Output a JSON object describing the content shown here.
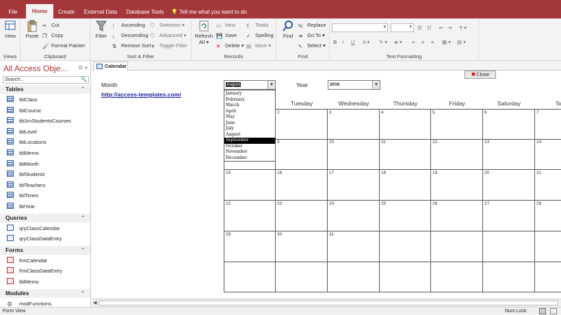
{
  "tabs": {
    "file": "File",
    "home": "Home",
    "create": "Create",
    "external": "External Data",
    "dbtools": "Database Tools",
    "tellme": "Tell me what you want to do"
  },
  "ribbon": {
    "views": {
      "label": "Views",
      "view": "View"
    },
    "clipboard": {
      "label": "Clipboard",
      "paste": "Paste",
      "cut": "Cut",
      "copy": "Copy",
      "format_painter": "Format Painter"
    },
    "sort_filter": {
      "label": "Sort & Filter",
      "filter": "Filter",
      "ascending": "Ascending",
      "descending": "Descending",
      "remove_sort": "Remove Sort",
      "selection": "Selection",
      "advanced": "Advanced",
      "toggle_filter": "Toggle Filter"
    },
    "records": {
      "label": "Records",
      "refresh": "Refresh",
      "all": "All",
      "new": "New",
      "save": "Save",
      "delete": "Delete",
      "totals": "Totals",
      "spelling": "Spelling",
      "more": "More"
    },
    "find": {
      "label": "Find",
      "find": "Find",
      "replace": "Replace",
      "goto": "Go To",
      "select": "Select"
    },
    "text_formatting": {
      "label": "Text Formatting",
      "bold": "B",
      "italic": "I",
      "underline": "U"
    }
  },
  "nav": {
    "title": "All Access Obje...",
    "search_placeholder": "Search...",
    "categories": [
      {
        "name": "Tables",
        "kind": "table",
        "items": [
          "tblClass",
          "tblCourse",
          "tblJrnStudentsCourses",
          "tblLevel",
          "tblLocations",
          "tblMemo",
          "tblMonth",
          "tblStudents",
          "tblTeachers",
          "tblTimes",
          "tblYear"
        ]
      },
      {
        "name": "Queries",
        "kind": "query",
        "items": [
          "qryClassCalendar",
          "qryClassDataEntry"
        ]
      },
      {
        "name": "Forms",
        "kind": "form",
        "items": [
          "frmCalendar",
          "frmClassDataEntry",
          "tblMemo"
        ]
      },
      {
        "name": "Modules",
        "kind": "module",
        "items": [
          "modFunctions"
        ]
      }
    ]
  },
  "document": {
    "tab": "Calendar"
  },
  "form": {
    "close": "Close",
    "month_label": "Month",
    "month_value": "August",
    "year_label": "Year",
    "year_value": "2016",
    "link": "http://access-templates.com/",
    "months": [
      "January",
      "February",
      "March",
      "April",
      "May",
      "June",
      "July",
      "August",
      "September",
      "October",
      "November",
      "December"
    ],
    "highlighted_month": "September",
    "weekdays": [
      "",
      "Tuesday",
      "Wednesday",
      "Thursday",
      "Friday",
      "Saturday",
      "Sun"
    ],
    "weeks": [
      [
        "",
        "2",
        "3",
        "4",
        "5",
        "6",
        "7"
      ],
      [
        "",
        "9",
        "10",
        "11",
        "12",
        "13",
        "14"
      ],
      [
        "15",
        "16",
        "17",
        "18",
        "19",
        "20",
        "21"
      ],
      [
        "22",
        "23",
        "24",
        "25",
        "26",
        "27",
        "28"
      ],
      [
        "29",
        "30",
        "31",
        "",
        "",
        "",
        ""
      ],
      [
        "",
        "",
        "",
        "",
        "",
        "",
        ""
      ]
    ]
  },
  "status": {
    "left": "Form View",
    "numlock": "Num Lock"
  }
}
